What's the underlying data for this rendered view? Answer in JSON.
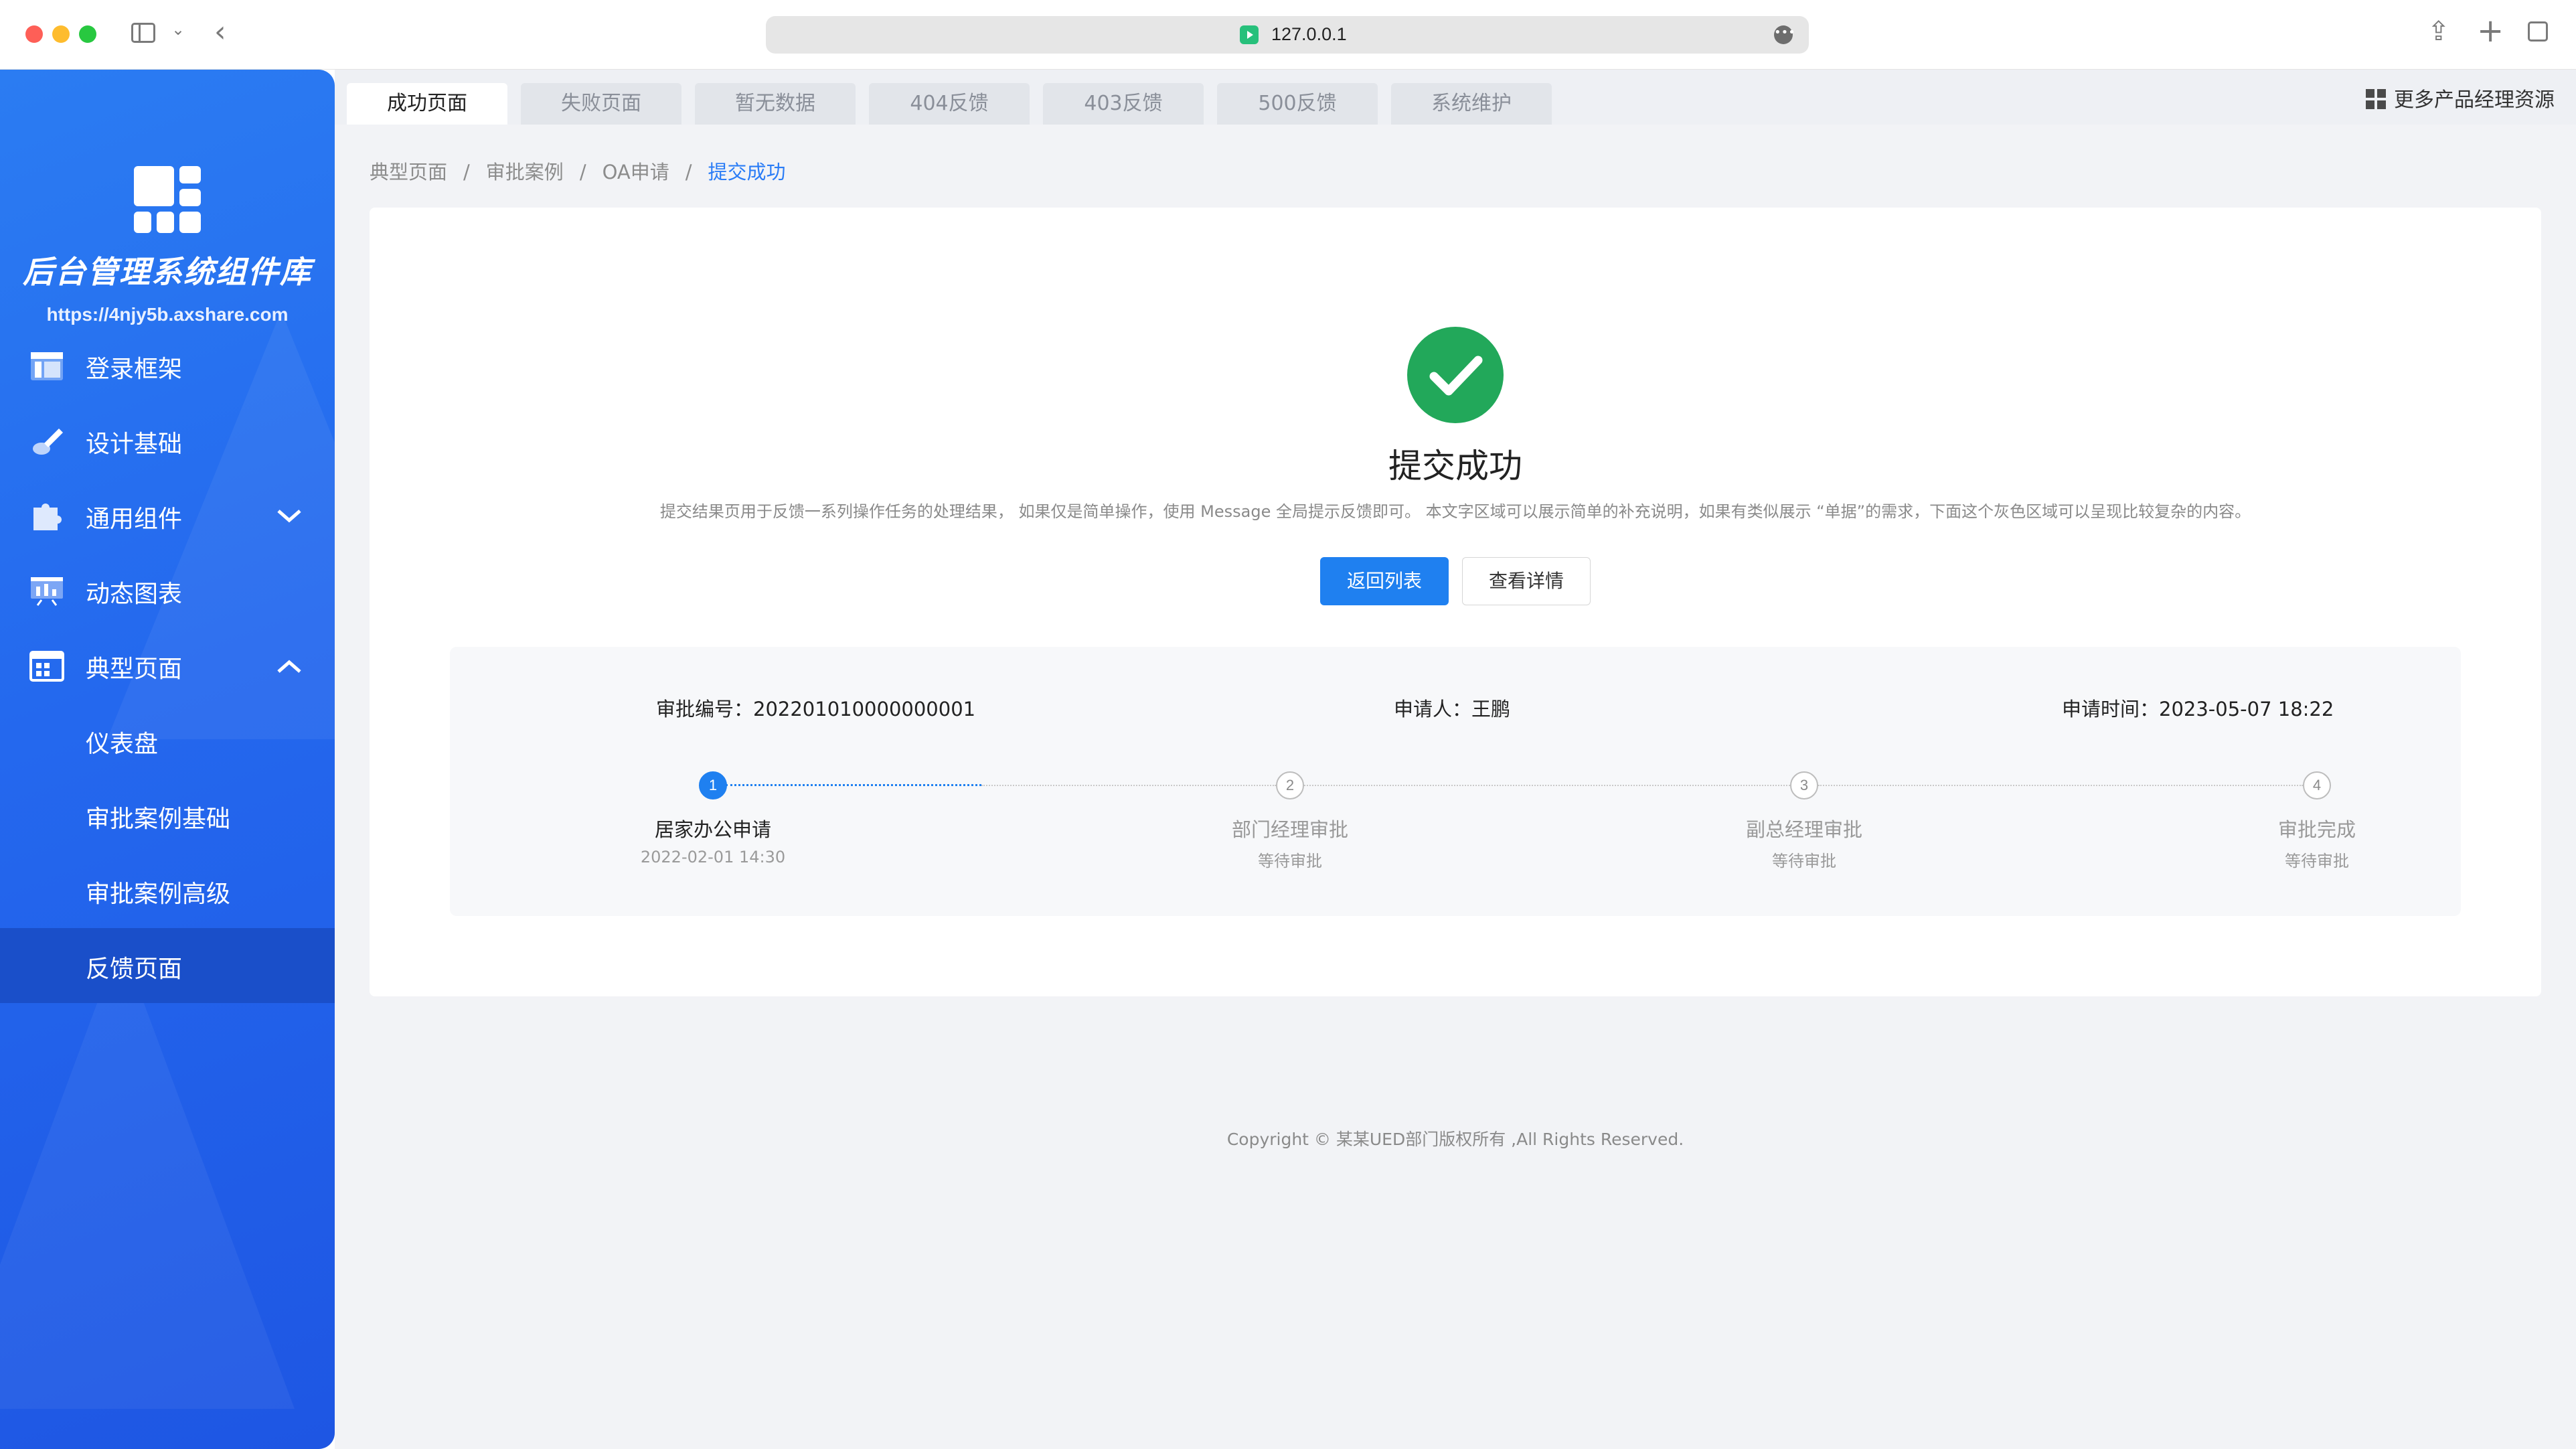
{
  "browser": {
    "url": "127.0.0.1",
    "traffic_lights": [
      "#fe5f57",
      "#febc2e",
      "#28c840"
    ]
  },
  "sidebar": {
    "brand": "后台管理系统组件库",
    "url": "https://4njy5b.axshare.com",
    "items": [
      {
        "label": "登录框架",
        "icon": "layout-icon"
      },
      {
        "label": "设计基础",
        "icon": "brush-icon"
      },
      {
        "label": "通用组件",
        "icon": "puzzle-icon",
        "chevron": "down"
      },
      {
        "label": "动态图表",
        "icon": "chart-board-icon"
      },
      {
        "label": "典型页面",
        "icon": "page-grid-icon",
        "chevron": "up"
      }
    ],
    "sub_items": [
      {
        "label": "仪表盘"
      },
      {
        "label": "审批案例基础"
      },
      {
        "label": "审批案例高级"
      },
      {
        "label": "反馈页面",
        "active": true
      }
    ]
  },
  "tabs": [
    "成功页面",
    "失败页面",
    "暂无数据",
    "404反馈",
    "403反馈",
    "500反馈",
    "系统维护"
  ],
  "more_resources": "更多产品经理资源",
  "breadcrumb": [
    "典型页面",
    "审批案例",
    "OA申请",
    "提交成功"
  ],
  "result": {
    "title": "提交成功",
    "description": "提交结果页用于反馈一系列操作任务的处理结果， 如果仅是简单操作，使用 Message 全局提示反馈即可。 本文字区域可以展示简单的补充说明，如果有类似展示 “单据”的需求，下面这个灰色区域可以呈现比较复杂的内容。",
    "primary_button": "返回列表",
    "secondary_button": "查看详情"
  },
  "details": {
    "approval_no": "审批编号：202201010000000001",
    "applicant": "申请人：王鹏",
    "apply_time": "申请时间：2023-05-07 18:22"
  },
  "steps": [
    {
      "num": "1",
      "title": "居家办公申请",
      "sub": "2022-02-01 14:30",
      "active": true
    },
    {
      "num": "2",
      "title": "部门经理审批",
      "sub": "等待审批"
    },
    {
      "num": "3",
      "title": "副总经理审批",
      "sub": "等待审批"
    },
    {
      "num": "4",
      "title": "审批完成",
      "sub": "等待审批"
    }
  ],
  "footer": "Copyright © 某某UED部门版权所有 ,All Rights Reserved.",
  "colors": {
    "primary": "#1f80f0",
    "success": "#22a85a",
    "sidebar": "#2468ee"
  }
}
